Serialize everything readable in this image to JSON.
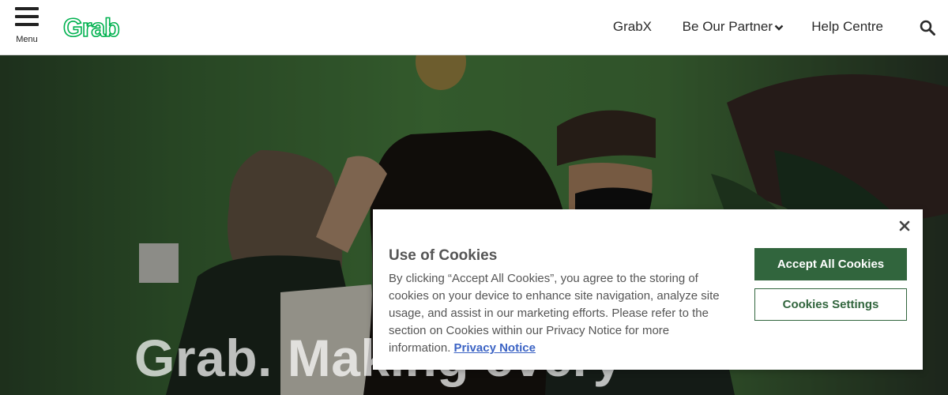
{
  "header": {
    "menu_label": "Menu",
    "logo_text": "Grab",
    "nav": {
      "grabx": "GrabX",
      "partner": "Be Our Partner",
      "help": "Help Centre"
    }
  },
  "hero": {
    "title": "Grab. Making every"
  },
  "cookie_banner": {
    "title": "Use of Cookies",
    "body": "By clicking “Accept All Cookies”, you agree to the storing of cookies on your device to enhance site navigation, analyze site usage, and assist in our marketing efforts. Please refer to the section on Cookies within our Privacy Notice for more information.",
    "privacy_link": "Privacy Notice",
    "accept_label": "Accept All Cookies",
    "settings_label": "Cookies Settings"
  },
  "colors": {
    "brand_green": "#00b14f",
    "button_green": "#31653d",
    "link_blue": "#3b63c4"
  },
  "icons": [
    "hamburger-menu-icon",
    "chevron-down-icon",
    "search-icon",
    "close-icon"
  ]
}
